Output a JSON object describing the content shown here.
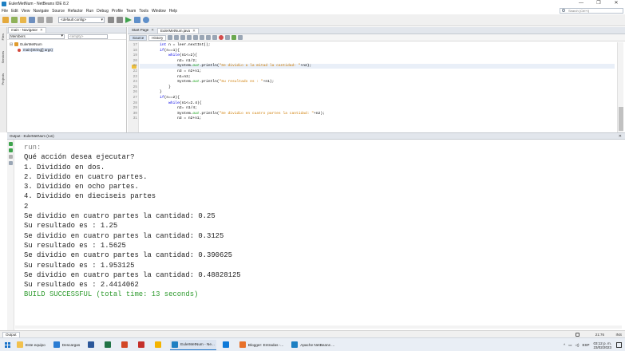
{
  "window": {
    "title": "EulerMetNum - NetBeans IDE 8.2",
    "controls": [
      "—",
      "❐",
      "✕"
    ]
  },
  "menu": [
    "File",
    "Edit",
    "View",
    "Navigate",
    "Source",
    "Refactor",
    "Run",
    "Debug",
    "Profile",
    "Team",
    "Tools",
    "Window",
    "Help"
  ],
  "search": {
    "placeholder": "Search (Ctrl+I)"
  },
  "toolbar": {
    "config": "<default config>"
  },
  "side_tabs": [
    "Files",
    "Services",
    "Projects"
  ],
  "navigator": {
    "tab": "main - Navigator",
    "filter": "Members",
    "empty_filter": "<empty>",
    "tree": [
      {
        "label": "EulerMetNum",
        "type": "class"
      },
      {
        "label": "main(String[] args)",
        "type": "method"
      }
    ]
  },
  "editor": {
    "tabs": [
      "Start Page",
      "EulerMetNum.java"
    ],
    "source_btn": "Source",
    "history_btn": "History",
    "lines": [
      {
        "n": "17",
        "code": "        int n = leer.nextInt();"
      },
      {
        "n": "18",
        "code": "        if(n==1){"
      },
      {
        "n": "19",
        "code": "            while(n1<=2){"
      },
      {
        "n": "20",
        "code": "                n2= n1/2;"
      },
      {
        "n": "21",
        "code": "                System.out.println(\"Se dividio a la mitad la cantidad: \"+n2);"
      },
      {
        "n": "22",
        "code": "                n3 = n2+n1;"
      },
      {
        "n": "23",
        "code": "                n1=n3;"
      },
      {
        "n": "24",
        "code": "                System.out.println(\"Su resultado es : \"+n1);"
      },
      {
        "n": "25",
        "code": "            }"
      },
      {
        "n": "26",
        "code": "        }"
      },
      {
        "n": "27",
        "code": "        if(n==2){"
      },
      {
        "n": "28",
        "code": "            while(n1<=2.4){"
      },
      {
        "n": "29",
        "code": "                n2= n1/4;"
      },
      {
        "n": "30",
        "code": "                System.out.println(\"Se dividio en cuatro partes la cantidad: \"+n2);"
      },
      {
        "n": "31",
        "code": "                n3 = n2+n1;"
      }
    ]
  },
  "output": {
    "title": "Output - EulerMetNum (run)",
    "lines": [
      {
        "text": "run:",
        "style": "gray"
      },
      {
        "text": "Qué acción desea ejecutar?",
        "style": ""
      },
      {
        "text": "1. Dividido en dos.",
        "style": ""
      },
      {
        "text": "2. Dividido en cuatro partes.",
        "style": ""
      },
      {
        "text": "3. Dividido en ocho partes.",
        "style": ""
      },
      {
        "text": "4. Dividido en dieciseis partes",
        "style": ""
      },
      {
        "text": "2",
        "style": ""
      },
      {
        "text": "Se dividio en cuatro partes la cantidad: 0.25",
        "style": ""
      },
      {
        "text": "Su resultado es : 1.25",
        "style": ""
      },
      {
        "text": "Se dividio en cuatro partes la cantidad: 0.3125",
        "style": ""
      },
      {
        "text": "Su resultado es : 1.5625",
        "style": ""
      },
      {
        "text": "Se dividio en cuatro partes la cantidad: 0.390625",
        "style": ""
      },
      {
        "text": "Su resultado es : 1.953125",
        "style": ""
      },
      {
        "text": "Se dividio en cuatro partes la cantidad: 0.48828125",
        "style": ""
      },
      {
        "text": "Su resultado es : 2.4414062",
        "style": ""
      },
      {
        "text": "BUILD SUCCESSFUL (total time: 13 seconds)",
        "style": "ok"
      }
    ]
  },
  "statusbar": {
    "output_tab": "Output",
    "position": "21:76",
    "mode": "INS"
  },
  "taskbar": {
    "items": [
      {
        "label": "Este equipo",
        "color": "#f2c14e"
      },
      {
        "label": "Descargas",
        "color": "#2b7cd3"
      },
      {
        "label": "",
        "color": "#2b579a"
      },
      {
        "label": "",
        "color": "#217346"
      },
      {
        "label": "",
        "color": "#d24726"
      },
      {
        "label": "",
        "color": "#c4302b"
      },
      {
        "label": "",
        "color": "#f4b400"
      },
      {
        "label": "EulerMetNum - Ne...",
        "color": "#1d7fc2"
      },
      {
        "label": "",
        "color": "#0f7ad8"
      },
      {
        "label": "Blogger: Entradas -...",
        "color": "#e8712a"
      },
      {
        "label": "Apache NetBeans ...",
        "color": "#1d7fc2"
      }
    ],
    "tray": {
      "lang": "ESP",
      "time": "03:12 p. m.",
      "date": "23/02/2023"
    }
  }
}
